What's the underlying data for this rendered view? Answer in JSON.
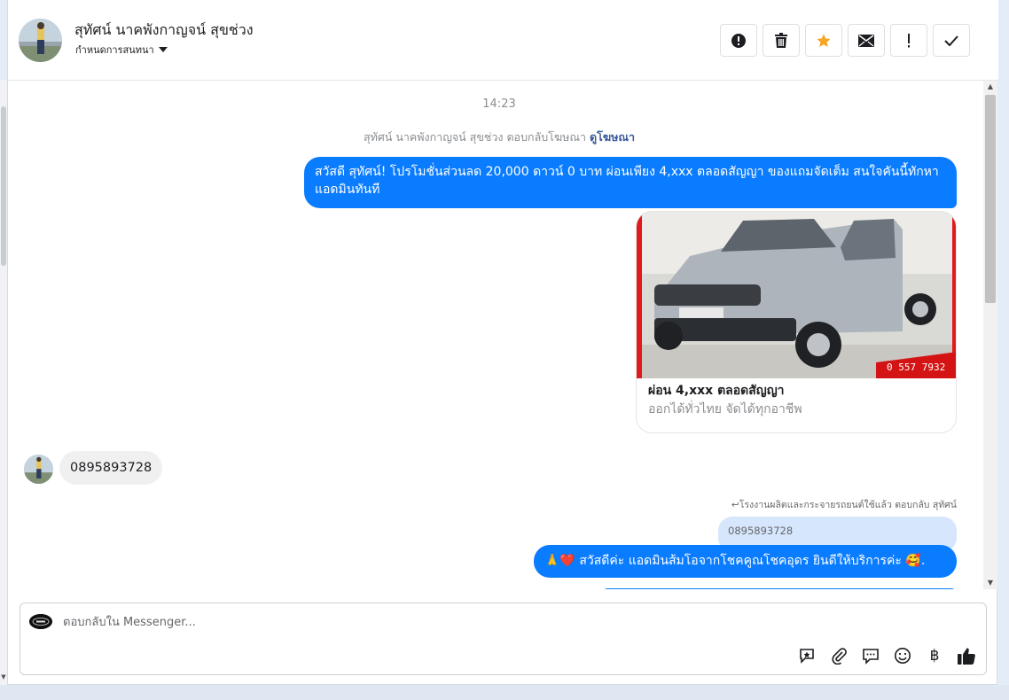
{
  "header": {
    "contact_name": "สุทัศน์ นาคพังกาญจน์ สุขช่วง",
    "assign_label": "กำหนดการสนทนา"
  },
  "thread": {
    "timestamp": "14:23",
    "ad_reply": {
      "text": "สุทัศน์ นาคพังกาญจน์ สุขช่วง ตอบกลับโฆษณา",
      "link": "ดูโฆษณา"
    },
    "outgoing_1": "สวัสดี สุทัศน์! โปรโมชั่นส่วนลด 20,000 ดาวน์ 0 บาท ผ่อนเพียง 4,xxx ตลอดสัญญา ของแถมจัดเต็ม สนใจคันนี้ทักหาแอดมินทันที",
    "ad_card": {
      "title": "ผ่อน 4,xxx ตลอดสัญญา",
      "description": "ออกได้ทั่วไทย จัดได้ทุกอาชีพ",
      "photo_overlay_text": "0 557 7932"
    },
    "incoming_1": "0895893728",
    "reply_note": "โรงงานผลิตและกระจายรถยนต์ใช้แล้ว ตอบกลับ สุทัศน์",
    "quoted_text": "0895893728",
    "outgoing_2": "🙏❤️ สวัสดีค่ะ แอดมินส้มโอจากโชคคูณโชคอุดร ยินดีให้บริการค่ะ 🥰."
  },
  "composer": {
    "placeholder": "ตอบกลับใน Messenger...",
    "currency_symbol": "฿"
  },
  "colors": {
    "accent": "#0a7cff",
    "star": "#f5a623",
    "incoming_bubble": "#f0f0f0",
    "quoted_bubble": "#d6e6fc"
  }
}
